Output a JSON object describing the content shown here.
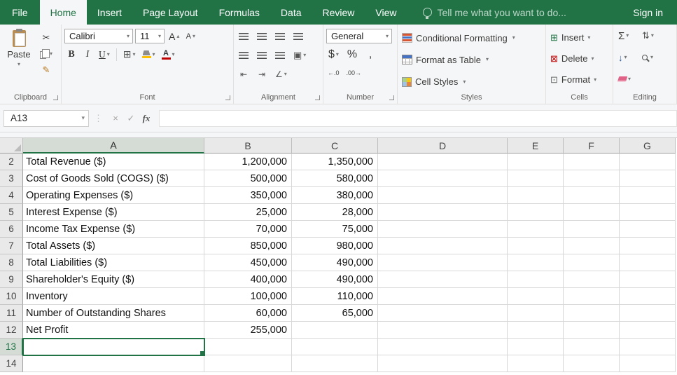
{
  "titlebar": {
    "tabs": [
      "File",
      "Home",
      "Insert",
      "Page Layout",
      "Formulas",
      "Data",
      "Review",
      "View"
    ],
    "active_tab": "Home",
    "tell_me": "Tell me what you want to do...",
    "sign_in": "Sign in"
  },
  "ribbon": {
    "clipboard": {
      "label": "Clipboard",
      "paste_label": "Paste"
    },
    "font": {
      "label": "Font",
      "font_name": "Calibri",
      "font_size": "11",
      "bold": "B",
      "italic": "I",
      "underline": "U"
    },
    "alignment": {
      "label": "Alignment"
    },
    "number": {
      "label": "Number",
      "format": "General",
      "currency": "$",
      "percent": "%",
      "comma": ",",
      "increase_decimal": "←.0",
      "decrease_decimal": ".00→"
    },
    "styles": {
      "label": "Styles",
      "conditional_formatting": "Conditional Formatting",
      "format_as_table": "Format as Table",
      "cell_styles": "Cell Styles"
    },
    "cells": {
      "label": "Cells",
      "insert": "Insert",
      "delete": "Delete",
      "format": "Format"
    },
    "editing": {
      "label": "Editing"
    }
  },
  "formula_bar": {
    "name_box": "A13",
    "fx": "fx",
    "value": ""
  },
  "icons": {
    "caret_down": "▾",
    "caret_up": "▴",
    "scissors": "✂",
    "format_painter": "✎",
    "borders": "⊞",
    "merge_center": "▣",
    "indent_decrease": "⇤",
    "indent_increase": "⇥",
    "orientation": "∠",
    "dots_separator": "⋮",
    "cancel": "×",
    "enter": "✓",
    "autosum": "Σ",
    "fill_down": "↓",
    "sort_filter": "⇅",
    "insert_cells": "⊞",
    "delete_cells": "⊠",
    "format_cells": "⊡",
    "font_color_letter": "A",
    "grow_font_letter": "A",
    "shrink_font_letter": "A"
  },
  "colors": {
    "excel_green": "#217346",
    "grid_line": "#d8d8d8",
    "header_bg": "#e9e9e9",
    "selected_header_bg": "#d5dcd5"
  },
  "grid": {
    "columns": [
      "A",
      "B",
      "C",
      "D",
      "E",
      "F",
      "G"
    ],
    "selected": {
      "col": "A",
      "row": 13
    },
    "rows": [
      {
        "n": 2,
        "cells": [
          "Total Revenue ($)",
          "1,200,000",
          "1,350,000"
        ]
      },
      {
        "n": 3,
        "cells": [
          "Cost of Goods Sold (COGS) ($)",
          "500,000",
          "580,000"
        ]
      },
      {
        "n": 4,
        "cells": [
          "Operating Expenses ($)",
          "350,000",
          "380,000"
        ]
      },
      {
        "n": 5,
        "cells": [
          "Interest Expense ($)",
          "25,000",
          "28,000"
        ]
      },
      {
        "n": 6,
        "cells": [
          "Income Tax Expense ($)",
          "70,000",
          "75,000"
        ]
      },
      {
        "n": 7,
        "cells": [
          "Total Assets ($)",
          "850,000",
          "980,000"
        ]
      },
      {
        "n": 8,
        "cells": [
          "Total Liabilities ($)",
          "450,000",
          "490,000"
        ]
      },
      {
        "n": 9,
        "cells": [
          "Shareholder's Equity ($)",
          "400,000",
          "490,000"
        ]
      },
      {
        "n": 10,
        "cells": [
          "Inventory",
          "100,000",
          "110,000"
        ]
      },
      {
        "n": 11,
        "cells": [
          "Number of Outstanding Shares",
          "60,000",
          "65,000"
        ]
      },
      {
        "n": 12,
        "cells": [
          "Net Profit",
          "255,000",
          ""
        ]
      },
      {
        "n": 13,
        "cells": [
          "",
          "",
          ""
        ]
      },
      {
        "n": 14,
        "cells": [
          "",
          "",
          ""
        ]
      }
    ]
  }
}
